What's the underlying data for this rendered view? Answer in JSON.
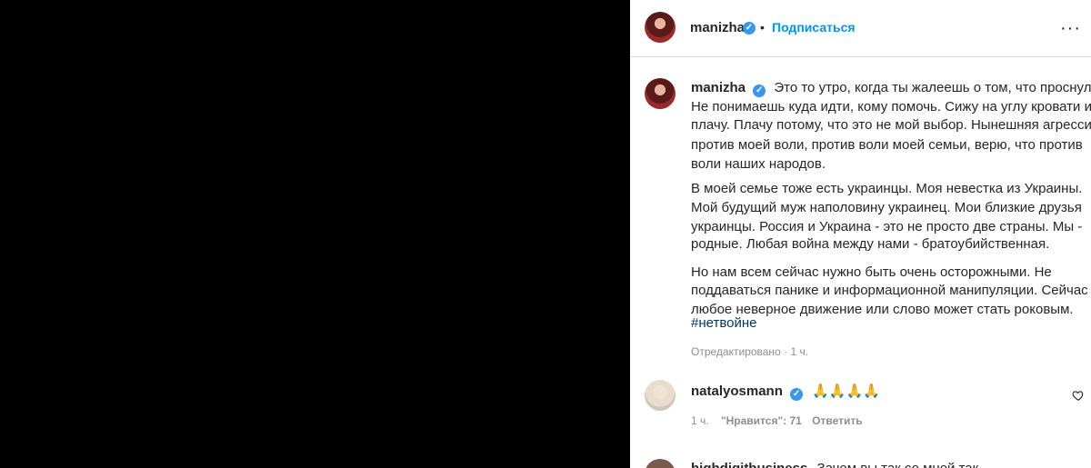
{
  "header": {
    "username": "manizha",
    "separator": "•",
    "follow_label": "Подписаться",
    "more_glyph": "···"
  },
  "caption": {
    "username": "manizha",
    "lines": [
      "Это то утро, когда ты жалеешь о том, что проснулся.",
      "Не понимаешь куда идти, кому помочь. Сижу на углу кровати и",
      "плачу. Плачу потому, что это не мой выбор. Нынешняя агрессия",
      "против моей воли, против воли моей семьи, верю, что против",
      "воли наших народов.",
      "В моей семье тоже есть украинцы. Моя невестка из Украины.",
      "Мой будущий муж наполовину украинец. Мои близкие друзья",
      "украинцы. Россия и Украина - это не просто две страны. Мы -",
      "родные. Любая война между нами - братоубийственная.",
      "Но нам всем сейчас нужно быть очень осторожными. Не",
      "поддаваться панике и информационной манипуляции. Сейчас",
      "любое неверное движение или слово может стать роковым."
    ],
    "first_line_after_name": "Это то утро, когда ты жалеешь о том, что проснулся.",
    "hashtag": "#нетвойне",
    "edited_label": "Отредактировано",
    "meta_sep": "·",
    "time": "1 ч."
  },
  "comments": [
    {
      "username": "natalyosmann",
      "text": "🙏🙏🙏🙏",
      "time": "1 ч.",
      "likes_label": "\"Нравится\": 71",
      "reply_label": "Ответить"
    },
    {
      "username": "highdigitbusiness",
      "text": "Зачем вы так со мной так"
    }
  ],
  "icons": {
    "verified": "verified-badge-icon",
    "like": "heart-icon",
    "more": "more-options-icon"
  },
  "colors": {
    "follow": "#0095f6",
    "verified": "#3897f0",
    "hashtag": "#00376b",
    "muted": "#8e8e8e"
  }
}
